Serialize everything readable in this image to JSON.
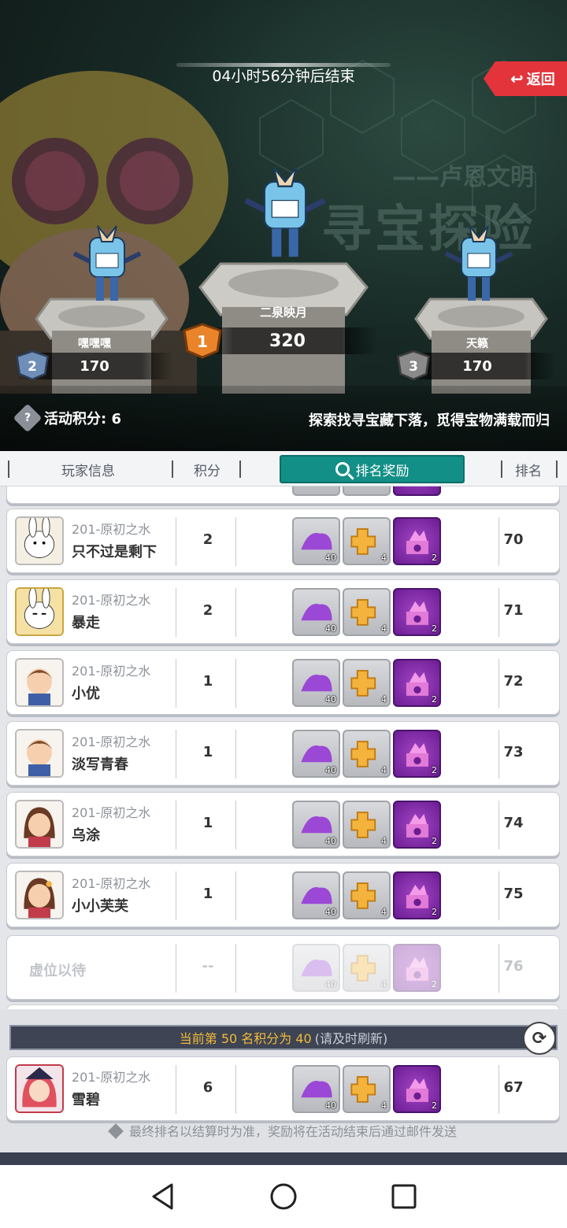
{
  "header": {
    "timer": "04小时56分钟后结束",
    "back_label": "返回",
    "watermark_sub": "——卢恩文明",
    "watermark_title": "寻宝探险",
    "podium": [
      {
        "rank": "1",
        "name": "二泉映月",
        "score": "320"
      },
      {
        "rank": "2",
        "name": "嘿嘿嘿",
        "score": "170"
      },
      {
        "rank": "3",
        "name": "天籁",
        "score": "170"
      }
    ],
    "points_label": "活动积分: 6",
    "slogan": "探索找寻宝藏下落，觅得宝物满载而归"
  },
  "columns": {
    "player_info": "玩家信息",
    "score": "积分",
    "reward": "排名奖励",
    "rank": "排名"
  },
  "reward_counts": [
    "40",
    "4",
    "2"
  ],
  "rows": [
    {
      "server": "201-原初之水",
      "name": "只不过是剩下",
      "score": "2",
      "rank": "70"
    },
    {
      "server": "201-原初之水",
      "name": "暴走",
      "score": "2",
      "rank": "71"
    },
    {
      "server": "201-原初之水",
      "name": "小优",
      "score": "1",
      "rank": "72"
    },
    {
      "server": "201-原初之水",
      "name": "淡写青春",
      "score": "1",
      "rank": "73"
    },
    {
      "server": "201-原初之水",
      "name": "乌涂",
      "score": "1",
      "rank": "74"
    },
    {
      "server": "201-原初之水",
      "name": "小小芙芙",
      "score": "1",
      "rank": "75"
    }
  ],
  "empty_row": {
    "label": "虚位以待",
    "score": "--",
    "rank": "76"
  },
  "footer": {
    "notice": "当前第 50 名积分为 40",
    "notice_hint": "(请及时刷新)",
    "my_row": {
      "server": "201-原初之水",
      "name": "雪碧",
      "score": "6",
      "rank": "67"
    },
    "footnote": "最终排名以结算时为准，奖励将在活动结束后通过邮件发送"
  },
  "colors": {
    "accent_teal": "#128f86",
    "back_red": "#e2343a",
    "notice_gold": "#f2b93a"
  }
}
